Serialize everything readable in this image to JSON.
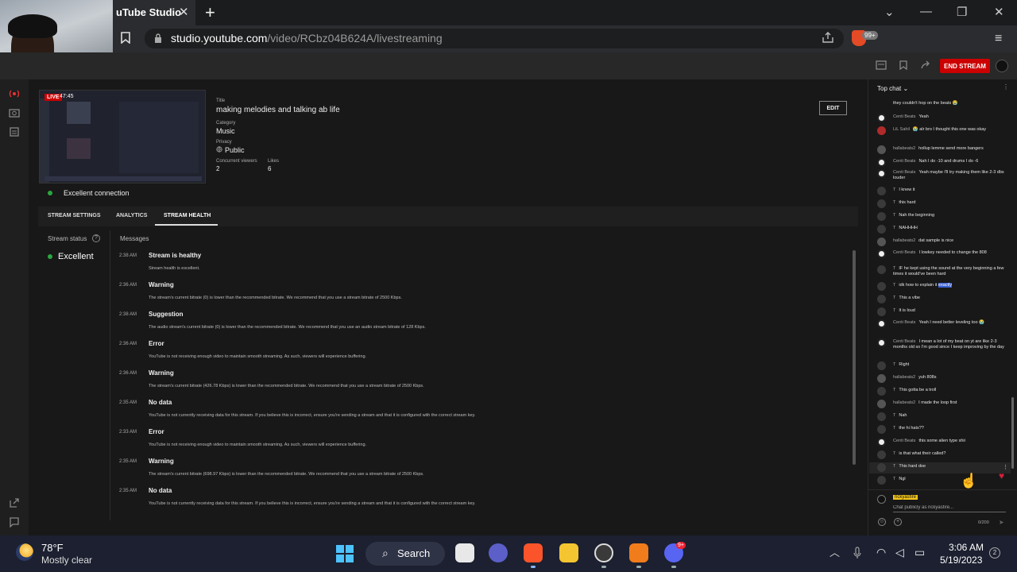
{
  "browser": {
    "tab_title": "uTube Studio",
    "tab_close": "✕",
    "new_tab": "+",
    "window_controls": [
      "⌄",
      "—",
      "❐",
      "✕"
    ],
    "url_domain": "studio.youtube.com",
    "url_path": "/video/RCbz04B624A/livestreaming",
    "extension_badge": "99+",
    "menu_glyph": "≡"
  },
  "studio_header": {
    "end_stream_label": "END STREAM"
  },
  "preview": {
    "live_label": "LIVE",
    "elapsed": "47:45",
    "connection_text": "Excellent connection"
  },
  "details": {
    "title_label": "Title",
    "title_value": "making melodies and talking ab life",
    "category_label": "Category",
    "category_value": "Music",
    "privacy_label": "Privacy",
    "privacy_value": "Public",
    "viewers_label": "Concurrent viewers",
    "viewers_value": "2",
    "likes_label": "Likes",
    "likes_value": "6",
    "edit_label": "EDIT"
  },
  "tabs": [
    {
      "label": "STREAM SETTINGS"
    },
    {
      "label": "ANALYTICS"
    },
    {
      "label": "STREAM HEALTH"
    }
  ],
  "health": {
    "status_heading": "Stream status",
    "help_glyph": "?",
    "status_value": "Excellent",
    "messages_heading": "Messages",
    "messages": [
      {
        "time": "2:38 AM",
        "title": "Stream is healthy",
        "desc": "Stream health is excellent."
      },
      {
        "time": "2:36 AM",
        "title": "Warning",
        "desc": "The stream's current bitrate (0) is lower than the recommended bitrate. We recommend that you use a stream bitrate of 2500 Kbps."
      },
      {
        "time": "2:38 AM",
        "title": "Suggestion",
        "desc": "The audio stream's current bitrate (0) is lower than the recommended bitrate. We recommend that you use an audio stream bitrate of 128 Kbps."
      },
      {
        "time": "2:36 AM",
        "title": "Error",
        "desc": "YouTube is not receiving enough video to maintain smooth streaming. As such, viewers will experience buffering."
      },
      {
        "time": "2:36 AM",
        "title": "Warning",
        "desc": "The stream's current bitrate (426.78 Kbps) is lower than the recommended bitrate. We recommend that you use a stream bitrate of 2500 Kbps."
      },
      {
        "time": "2:35 AM",
        "title": "No data",
        "desc": "YouTube is not currently receiving data for this stream. If you believe this is incorrect, ensure you're sending a stream and that it is configured with the correct stream key."
      },
      {
        "time": "2:33 AM",
        "title": "Error",
        "desc": "YouTube is not receiving enough video to maintain smooth streaming. As such, viewers will experience buffering."
      },
      {
        "time": "2:35 AM",
        "title": "Warning",
        "desc": "The stream's current bitrate (698.97 Kbps) is lower than the recommended bitrate. We recommend that you use a stream bitrate of 2500 Kbps."
      },
      {
        "time": "2:35 AM",
        "title": "No data",
        "desc": "YouTube is not currently receiving data for this stream. If you believe this is incorrect, ensure you're sending a stream and that it is configured with the correct stream key."
      }
    ]
  },
  "chat": {
    "header": "Top chat",
    "messages": [
      {
        "author": "",
        "text": "they couldn't hop on the beats 😭"
      },
      {
        "author": "Centi Beats",
        "text": "Yeah"
      },
      {
        "author": "LiL Sahil",
        "text": "😭 alr bro I thought this one was okay"
      },
      {
        "author": "hallabeats2",
        "text": "hollup lemme send more bangers"
      },
      {
        "author": "Centi Beats",
        "text": "Nah I do -10 and drums I do -6"
      },
      {
        "author": "Centi Beats",
        "text": "Yeah maybe I'll try making them like 2-3 dbs louder"
      },
      {
        "author": "T",
        "text": "I knew it"
      },
      {
        "author": "T",
        "text": "this hard"
      },
      {
        "author": "T",
        "text": "Nah the beginning"
      },
      {
        "author": "T",
        "text": "NAHHHH"
      },
      {
        "author": "hallabeats2",
        "text": "dat sample is nice"
      },
      {
        "author": "Centi Beats",
        "text": "I lowkey needed to change the 808"
      },
      {
        "author": "T",
        "text": "IF he kept using the sound at the very beginning a few times it would've been hard"
      },
      {
        "author": "T",
        "text": "idk how to explain it ",
        "highlight": "exactly"
      },
      {
        "author": "T",
        "text": "This a vibe"
      },
      {
        "author": "T",
        "text": "It is loud"
      },
      {
        "author": "Centi Beats",
        "text": "Yeah I need better leveling too 😭"
      },
      {
        "author": "Centi Beats",
        "text": "I mean a lot of my beat on yt are like 2-3 months old so I'm good since I keep improving by the day"
      },
      {
        "author": "T",
        "text": "Right"
      },
      {
        "author": "hallabeats2",
        "text": "yuh 808s"
      },
      {
        "author": "T",
        "text": "This gotta be a troll"
      },
      {
        "author": "hallabeats2",
        "text": "I made the loop first"
      },
      {
        "author": "T",
        "text": "Nah"
      },
      {
        "author": "T",
        "text": "the hi hats??"
      },
      {
        "author": "Centi Beats",
        "text": "this some alien type shii"
      },
      {
        "author": "T",
        "text": "is that what their called?"
      },
      {
        "author": "T",
        "text": "This hard doe"
      },
      {
        "author": "T",
        "text": "Ngl"
      }
    ],
    "my_name": "rickyasfire",
    "input_placeholder": "Chat publicly as rickyasfire...",
    "char_count": "0/200"
  },
  "taskbar": {
    "temperature": "78°F",
    "weather": "Mostly clear",
    "search_label": "Search",
    "discord_badge": "9+",
    "time": "3:06 AM",
    "date": "5/19/2023",
    "notifications": "2"
  }
}
